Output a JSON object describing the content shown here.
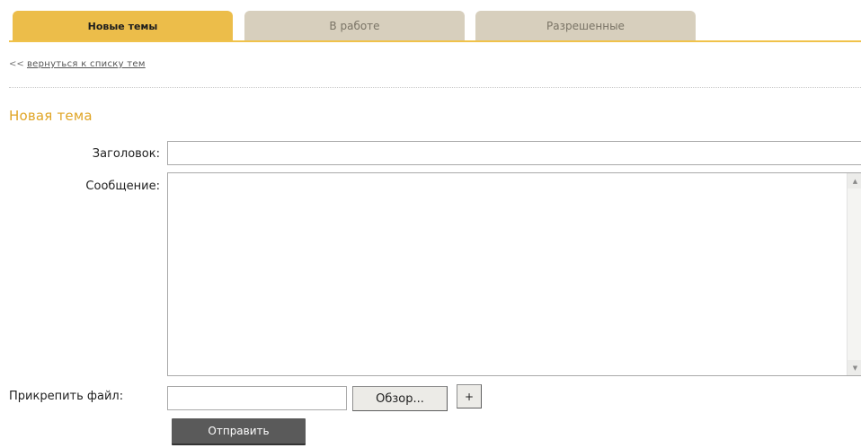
{
  "tabs": [
    {
      "label": "Новые темы",
      "active": true
    },
    {
      "label": "В работе",
      "active": false
    },
    {
      "label": "Разрешенные",
      "active": false
    }
  ],
  "back": {
    "arrows": "<<",
    "link_label": "вернуться к списку тем"
  },
  "form": {
    "heading": "Новая тема",
    "title_label": "Заголовок:",
    "title_value": "",
    "message_label": "Сообщение:",
    "message_value": "",
    "file_label": "Прикрепить файл:",
    "file_value": "",
    "browse_label": "Обзор...",
    "add_label": "+",
    "submit_label": "Отправить"
  },
  "icons": {
    "scroll_up": "scroll-up-arrow-icon",
    "scroll_down": "scroll-down-arrow-icon"
  },
  "colors": {
    "accent": "#ecbd4a",
    "heading": "#e0a526",
    "tab_inactive": "#d7cfbd",
    "submit_bg": "#5a5a5a"
  }
}
